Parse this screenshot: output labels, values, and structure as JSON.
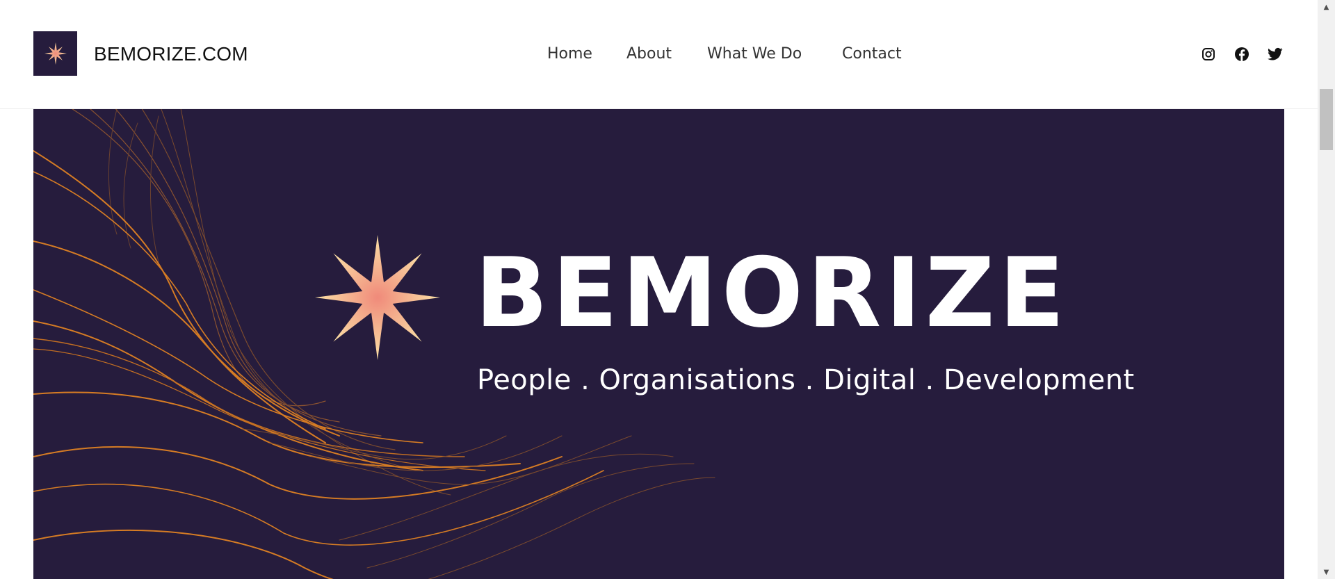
{
  "header": {
    "logo_icon": "sparkle-star-icon",
    "site_title": "BEMORIZE.COM"
  },
  "nav": {
    "items": [
      {
        "label": "Home"
      },
      {
        "label": "About"
      },
      {
        "label": "What We Do"
      },
      {
        "label": "Contact"
      }
    ]
  },
  "social": {
    "icons": [
      "instagram-icon",
      "facebook-icon",
      "twitter-icon"
    ]
  },
  "hero": {
    "brand_name": "BEMORIZE",
    "tagline": "People . Organisations . Digital . Development",
    "background_color": "#261c3d",
    "accent_color": "#e8892a",
    "star_colors": [
      "#fbe1a6",
      "#f08a7a"
    ]
  },
  "scrollbar": {
    "up_arrow": "▲",
    "down_arrow": "▼"
  }
}
